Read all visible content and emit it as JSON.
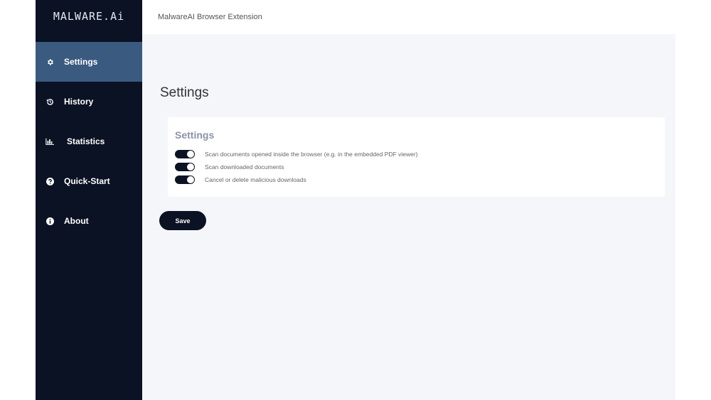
{
  "app": {
    "logo_text": "MALWARE.Ai",
    "header_title": "MalwareAI Browser Extension"
  },
  "sidebar": {
    "items": [
      {
        "label": "Settings",
        "icon": "gear-icon",
        "active": true
      },
      {
        "label": "History",
        "icon": "history-icon",
        "active": false
      },
      {
        "label": "Statistics",
        "icon": "bar-chart-icon",
        "active": false
      },
      {
        "label": "Quick-Start",
        "icon": "question-circle-icon",
        "active": false
      },
      {
        "label": "About",
        "icon": "info-circle-icon",
        "active": false
      }
    ]
  },
  "main": {
    "page_title": "Settings",
    "card": {
      "title": "Settings",
      "options": [
        {
          "label": "Scan documents opened inside the browser (e.g. in the embedded PDF viewer)",
          "enabled": true
        },
        {
          "label": "Scan downloaded documents",
          "enabled": true
        },
        {
          "label": "Cancel or delete malicious downloads",
          "enabled": true
        }
      ]
    },
    "save_label": "Save"
  },
  "colors": {
    "sidebar_bg": "#0b1224",
    "active_item_bg": "#3a5a80",
    "content_bg": "#f4f6fa",
    "card_title": "#8a93a8"
  }
}
